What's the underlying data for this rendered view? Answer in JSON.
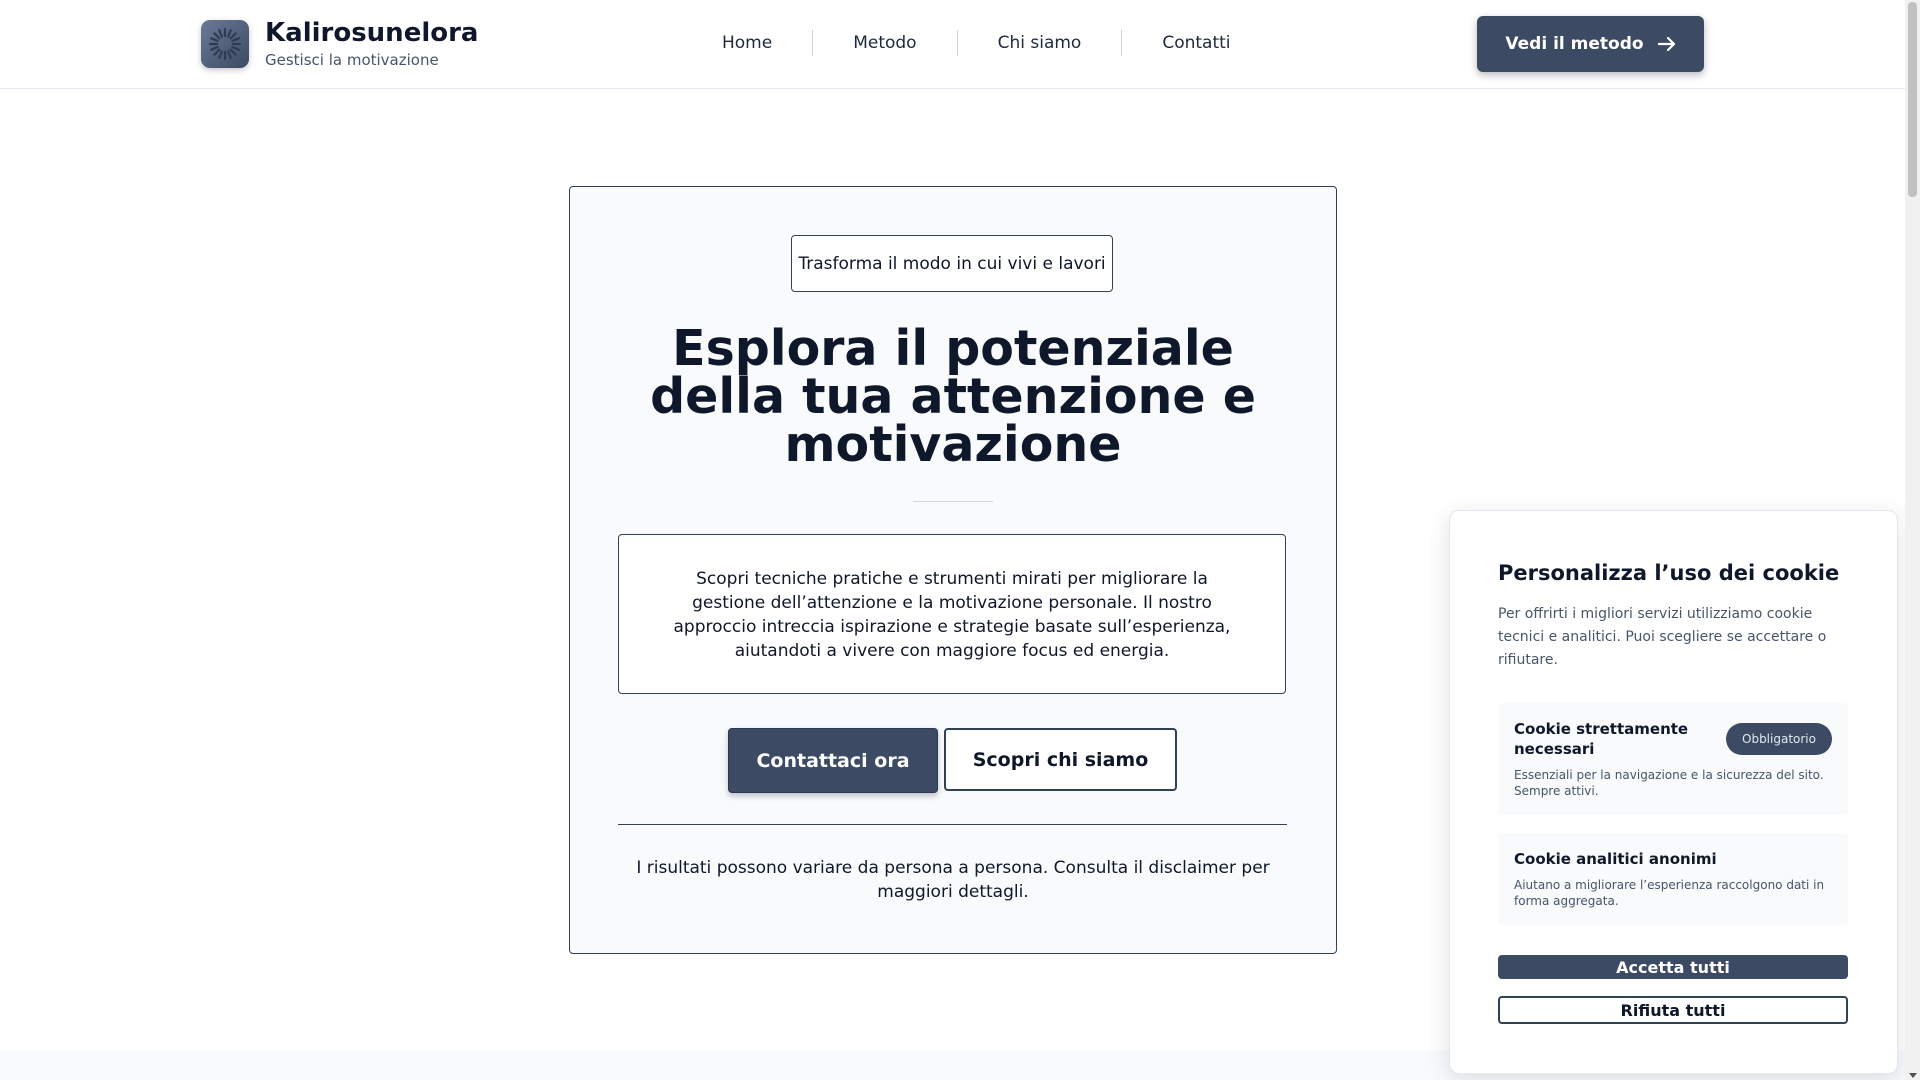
{
  "header": {
    "brand_name": "Kalirosunelora",
    "brand_tagline": "Gestisci la motivazione",
    "logo_icon": "sunburst-logo-icon",
    "nav": [
      "Home",
      "Metodo",
      "Chi siamo",
      "Contatti"
    ],
    "cta_label": "Vedi il metodo",
    "cta_icon": "arrow-right-icon"
  },
  "hero": {
    "eyebrow": "Trasforma il modo in cui vivi e lavori",
    "title": "Esplora il potenziale della tua attenzione e motivazione",
    "description": "Scopri tecniche pratiche e strumenti mirati per migliorare la gestione dell’attenzione e la motivazione personale. Il nostro approccio intreccia ispirazione e strategie basate sull’esperienza, aiutandoti a vivere con maggiore focus ed energia.",
    "primary_button": "Contattaci ora",
    "secondary_button": "Scopri chi siamo",
    "disclaimer": "I risultati possono variare da persona a persona. Consulta il disclaimer per maggiori dettagli."
  },
  "cookie": {
    "title": "Personalizza l’uso dei cookie",
    "intro": "Per offrirti i migliori servizi utilizziamo cookie tecnici e analitici. Puoi scegliere se accettare o rifiutare.",
    "necessary": {
      "title": "Cookie strettamente necessari",
      "badge": "Obbligatorio",
      "description": "Essenziali per la navigazione e la sicurezza del sito. Sempre attivi."
    },
    "analytics": {
      "title": "Cookie analitici anonimi",
      "description": "Aiutano a migliorare l’esperienza raccolgono dati in forma aggregata."
    },
    "accept_label": "Accetta tutti",
    "reject_label": "Rifiuta tutti"
  },
  "colors": {
    "primary": "#3c4a63",
    "text": "#0f172a",
    "muted": "#475569",
    "card_background": "#f8fafc",
    "border": "#334155"
  }
}
